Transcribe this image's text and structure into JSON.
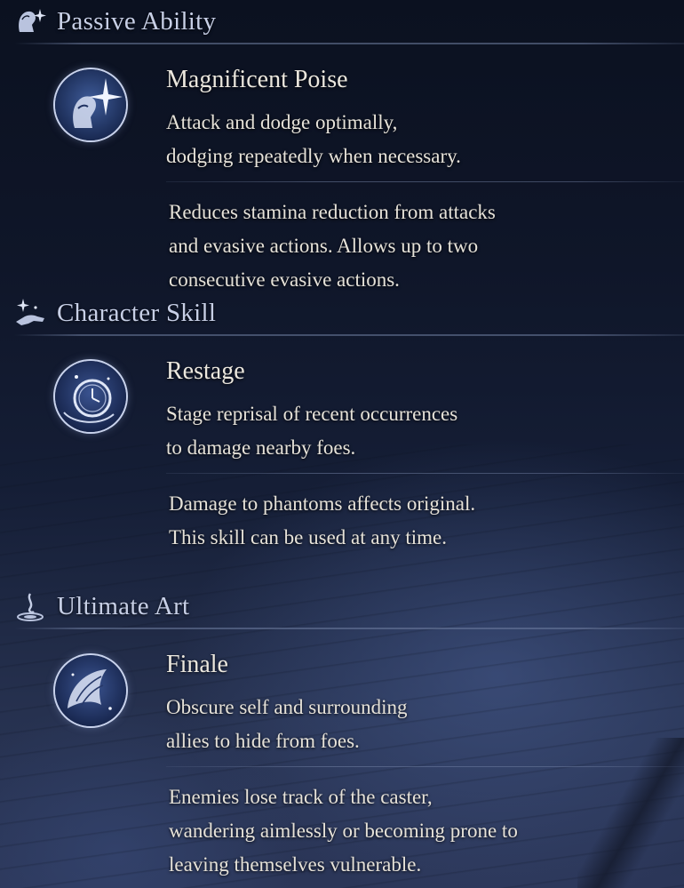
{
  "colors": {
    "section_title": "#c7cfe6",
    "text": "#e6e2d9",
    "icon_ring": "#c8d2ec"
  },
  "sections": [
    {
      "title": "Passive Ability",
      "icon": "sparkle-head-icon",
      "skill": {
        "name": "Magnificent Poise",
        "icon": "profile-star-icon",
        "description": [
          "Attack and dodge optimally,",
          "dodging repeatedly when necessary."
        ],
        "detail": [
          "Reduces stamina reduction from attacks",
          "and evasive actions. Allows up to two",
          "consecutive evasive actions."
        ]
      }
    },
    {
      "title": "Character Skill",
      "icon": "sparkle-hand-icon",
      "skill": {
        "name": "Restage",
        "icon": "pocket-watch-icon",
        "description": [
          "Stage reprisal of recent occurrences",
          "to damage nearby foes."
        ],
        "detail": [
          "Damage to phantoms affects original.",
          "This skill can be used at any time."
        ]
      }
    },
    {
      "title": "Ultimate Art",
      "icon": "swirl-flame-icon",
      "skill": {
        "name": "Finale",
        "icon": "wing-cloak-icon",
        "description": [
          "Obscure self and surrounding",
          "allies to hide from foes."
        ],
        "detail": [
          "Enemies lose track of the caster,",
          "wandering aimlessly or becoming prone to",
          "leaving themselves vulnerable."
        ]
      }
    }
  ]
}
